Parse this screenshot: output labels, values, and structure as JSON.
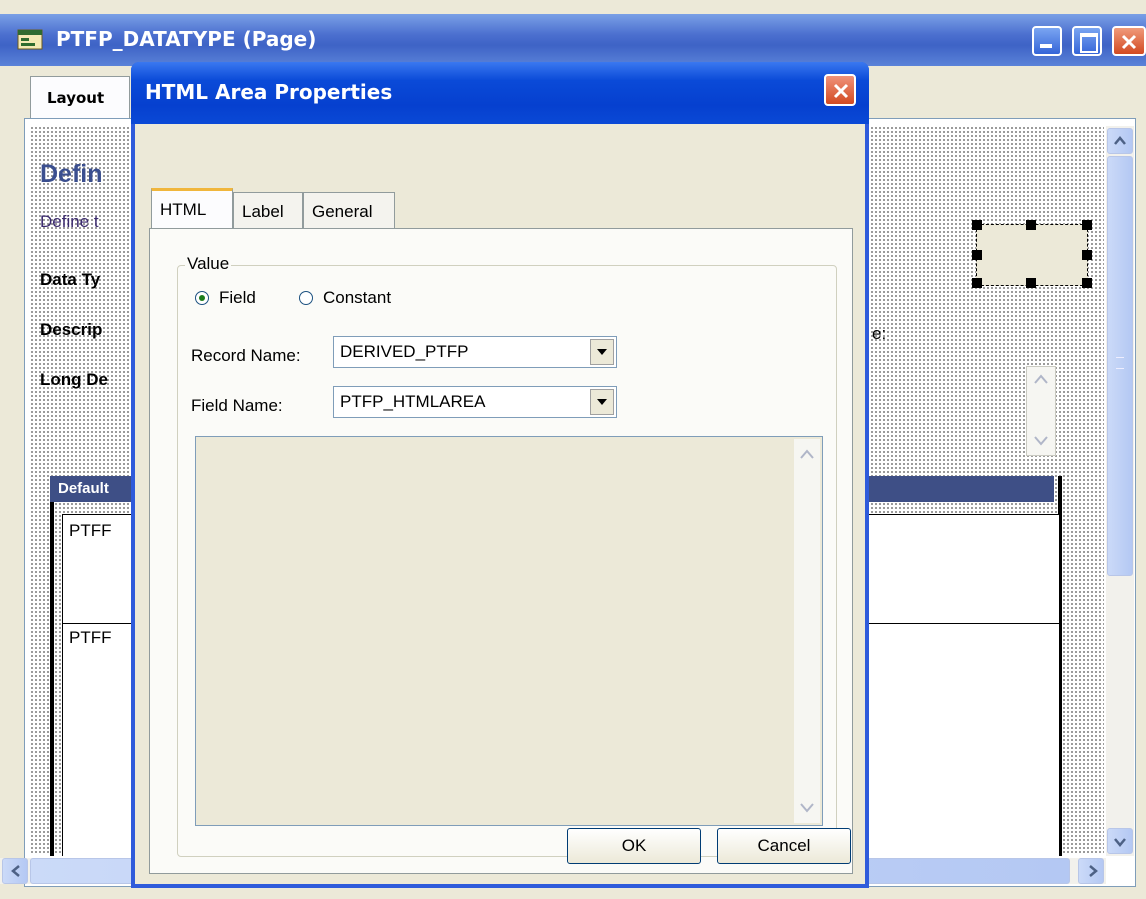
{
  "window": {
    "title": "PTFP_DATATYPE (Page)",
    "tab_layout": "Layout"
  },
  "canvas": {
    "heading": "Defin",
    "subtext": "Define t",
    "field1": "Data Ty",
    "field2": "Descrip",
    "field3": "Long De",
    "right_fragment": "e:",
    "grid_header": "Default",
    "grid_row1": "PTFF",
    "grid_row2": "PTFF"
  },
  "dialog": {
    "title": "HTML Area Properties",
    "tabs": [
      "HTML",
      "Label",
      "General"
    ],
    "group_label": "Value",
    "radio_field": "Field",
    "radio_constant": "Constant",
    "record_name_label": "Record Name:",
    "record_name_value": "DERIVED_PTFP",
    "field_name_label": "Field Name:",
    "field_name_value": "PTFP_HTMLAREA",
    "ok": "OK",
    "cancel": "Cancel"
  },
  "colors": {
    "title_bar": "#0a4ad8",
    "dialog_body": "#ece9d8",
    "heading_text": "#3b4f8f",
    "grid_header_bg": "#3e4f86"
  }
}
